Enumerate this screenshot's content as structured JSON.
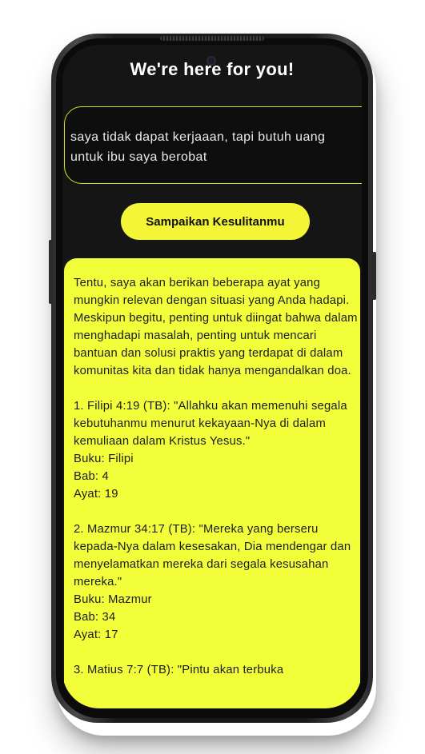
{
  "header": {
    "title": "We're here for you!"
  },
  "input": {
    "value": "saya tidak dapat kerjaaan, tapi butuh uang untuk ibu saya berobat"
  },
  "submit": {
    "label": "Sampaikan Kesulitanmu"
  },
  "response": {
    "intro": "Tentu, saya akan berikan beberapa ayat yang mungkin relevan dengan situasi yang Anda hadapi. Meskipun begitu, penting untuk diingat bahwa dalam menghadapi masalah, penting untuk mencari bantuan dan solusi praktis yang terdapat di dalam komunitas kita dan tidak hanya mengandalkan doa.",
    "verses": [
      {
        "quote": "1. Filipi 4:19 (TB): \"Allahku akan memenuhi segala kebutuhanmu menurut kekayaan-Nya di dalam kemuliaan dalam Kristus Yesus.\"",
        "book": "Buku: Filipi",
        "chapter": "Bab: 4",
        "verse": "Ayat: 19"
      },
      {
        "quote": "2. Mazmur 34:17 (TB): \"Mereka yang berseru kepada-Nya dalam kesesakan, Dia mendengar dan menyelamatkan mereka dari segala kesusahan mereka.\"",
        "book": "Buku: Mazmur",
        "chapter": "Bab: 34",
        "verse": "Ayat: 17"
      },
      {
        "quote": "3. Matius 7:7 (TB): \"Pintu akan terbuka"
      }
    ]
  }
}
